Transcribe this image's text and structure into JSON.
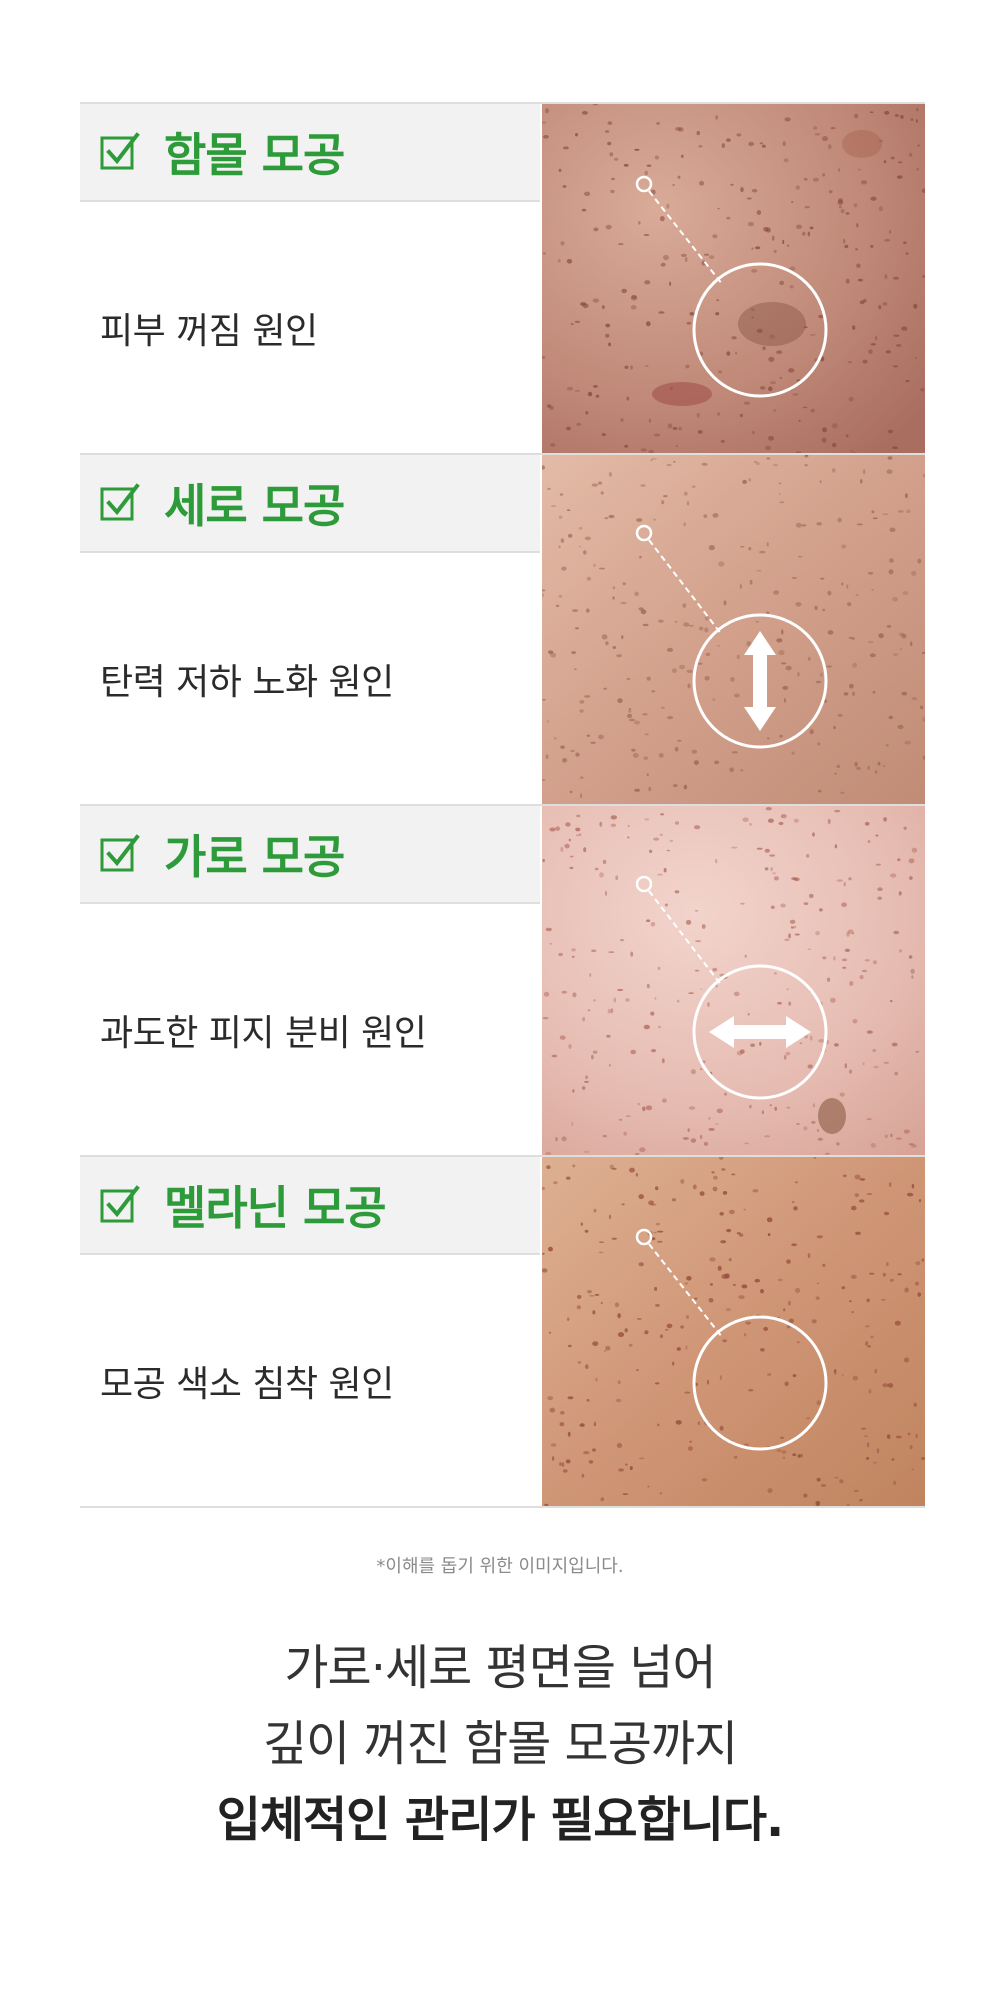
{
  "pore_types": [
    {
      "title": "함몰 모공",
      "cause": "피부 꺼짐 원인",
      "icon": "checkbox-check-icon",
      "indicator": "circle",
      "skin_colors": [
        "#c08978",
        "#9c5d52",
        "#d9ab98"
      ]
    },
    {
      "title": "세로 모공",
      "cause": "탄력 저하 노화 원인",
      "icon": "checkbox-check-icon",
      "indicator": "vertical-arrow-icon",
      "skin_colors": [
        "#d2a08b",
        "#b07966",
        "#e3bba6"
      ]
    },
    {
      "title": "가로 모공",
      "cause": "과도한 피지 분비 원인",
      "icon": "checkbox-check-icon",
      "indicator": "horizontal-arrow-icon",
      "skin_colors": [
        "#e6bcb2",
        "#c38478",
        "#f2d4cc"
      ]
    },
    {
      "title": "멜라닌 모공",
      "cause": "모공 색소 침착 원인",
      "icon": "checkbox-check-icon",
      "indicator": "circle",
      "skin_colors": [
        "#cf9676",
        "#a45b44",
        "#ddb092"
      ]
    }
  ],
  "note": "*이해를 돕기 위한 이미지입니다.",
  "closing": {
    "line1": "가로·세로 평면을 넘어",
    "line2": "깊이 꺼진 함몰 모공까지",
    "line3": "입체적인 관리가 필요합니다."
  },
  "colors": {
    "accent": "#2e9b3a",
    "header_bg": "#f2f2f2",
    "border": "#dedede"
  }
}
